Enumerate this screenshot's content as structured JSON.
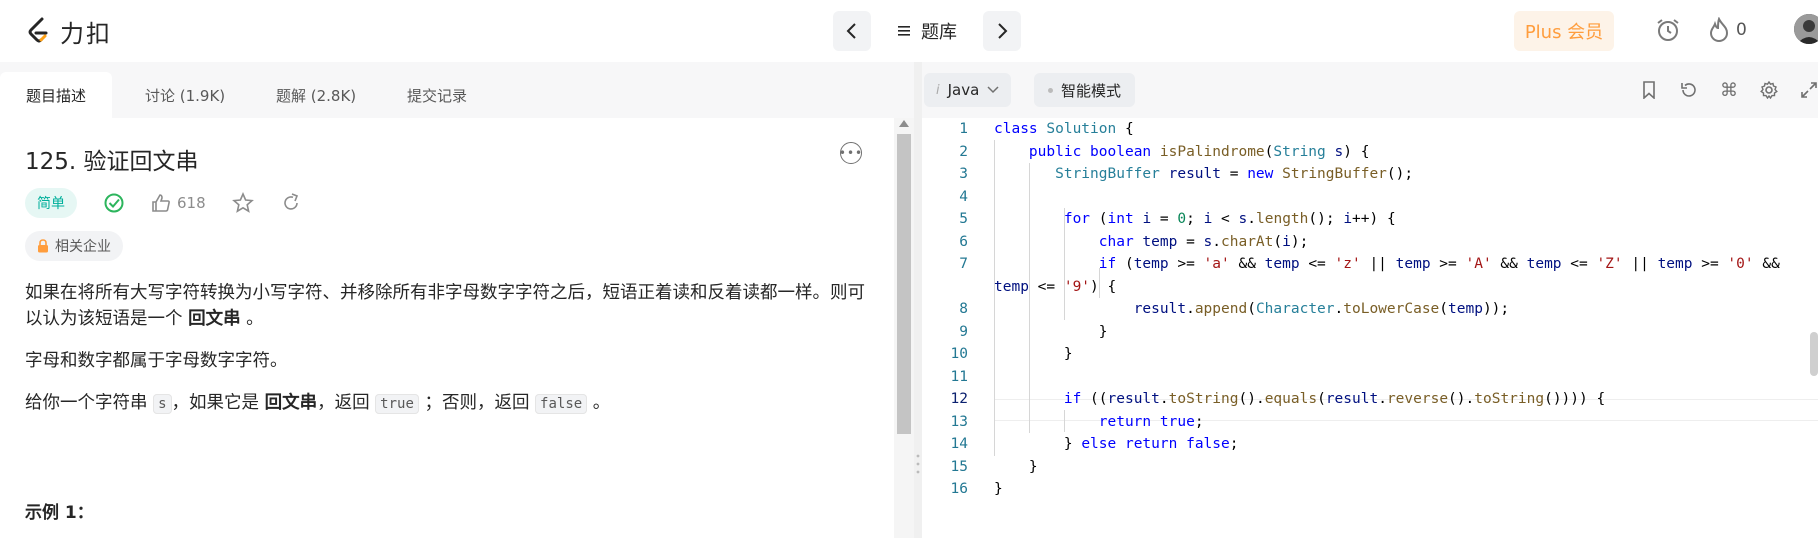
{
  "app": {
    "logo_text": "力扣"
  },
  "nav": {
    "problem_list_label": "题库",
    "plus_label": "Plus 会员",
    "streak_count": "0"
  },
  "tabs": [
    {
      "label": "题目描述"
    },
    {
      "label": "讨论 (1.9K)"
    },
    {
      "label": "题解 (2.8K)"
    },
    {
      "label": "提交记录"
    }
  ],
  "problem": {
    "title": "125. 验证回文串",
    "difficulty": "简单",
    "likes": "618",
    "companies_label": "相关企业",
    "desc1_prefix": "如果在将所有大写字符转换为小写字符、并移除所有非字母数字字符之后，短语正着读和反着读都一样。则可以认为该短语是一个",
    "desc1_bold": "回文串",
    "desc1_suffix": "。",
    "desc2": "字母和数字都属于字母数字字符。",
    "desc3_a": "给你一个字符串",
    "desc3_code1": "s",
    "desc3_b": "，如果它是",
    "desc3_bold": "回文串",
    "desc3_c": "，返回",
    "desc3_code2": "true",
    "desc3_d": "；否则，返回",
    "desc3_code3": "false",
    "desc3_e": "。",
    "example_heading": "示例 1："
  },
  "editor": {
    "language": "Java",
    "mode_label": "智能模式",
    "line_numbers": [
      "1",
      "2",
      "3",
      "4",
      "5",
      "6",
      "7",
      "8",
      "9",
      "10",
      "11",
      "12",
      "13",
      "14",
      "15",
      "16"
    ]
  }
}
